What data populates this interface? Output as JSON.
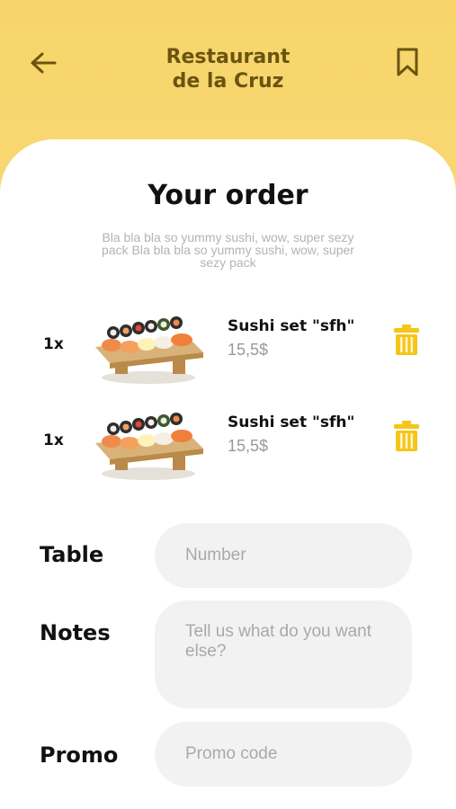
{
  "header": {
    "title_line1": "Restaurant",
    "title_line2": "de la Cruz"
  },
  "order": {
    "title": "Your order",
    "description": "Bla bla bla so yummy sushi, wow, super sezy pack Bla bla bla so yummy sushi, wow, super sezy pack",
    "items": [
      {
        "qty": "1x",
        "name": "Sushi set \"sfh\"",
        "price": "15,5$"
      },
      {
        "qty": "1x",
        "name": "Sushi set \"sfh\"",
        "price": "15,5$"
      }
    ]
  },
  "form": {
    "table_label": "Table",
    "table_placeholder": "Number",
    "notes_label": "Notes",
    "notes_placeholder": "Tell us what do you want else?",
    "promo_label": "Promo",
    "promo_placeholder": "Promo code"
  },
  "colors": {
    "header_bg": "#f7d56a",
    "title_color": "#6b5410",
    "trash_color": "#f5c518",
    "field_bg": "#f2f2f2"
  },
  "icons": {
    "back": "arrow-left-icon",
    "bookmark": "bookmark-icon",
    "delete": "trash-icon"
  }
}
